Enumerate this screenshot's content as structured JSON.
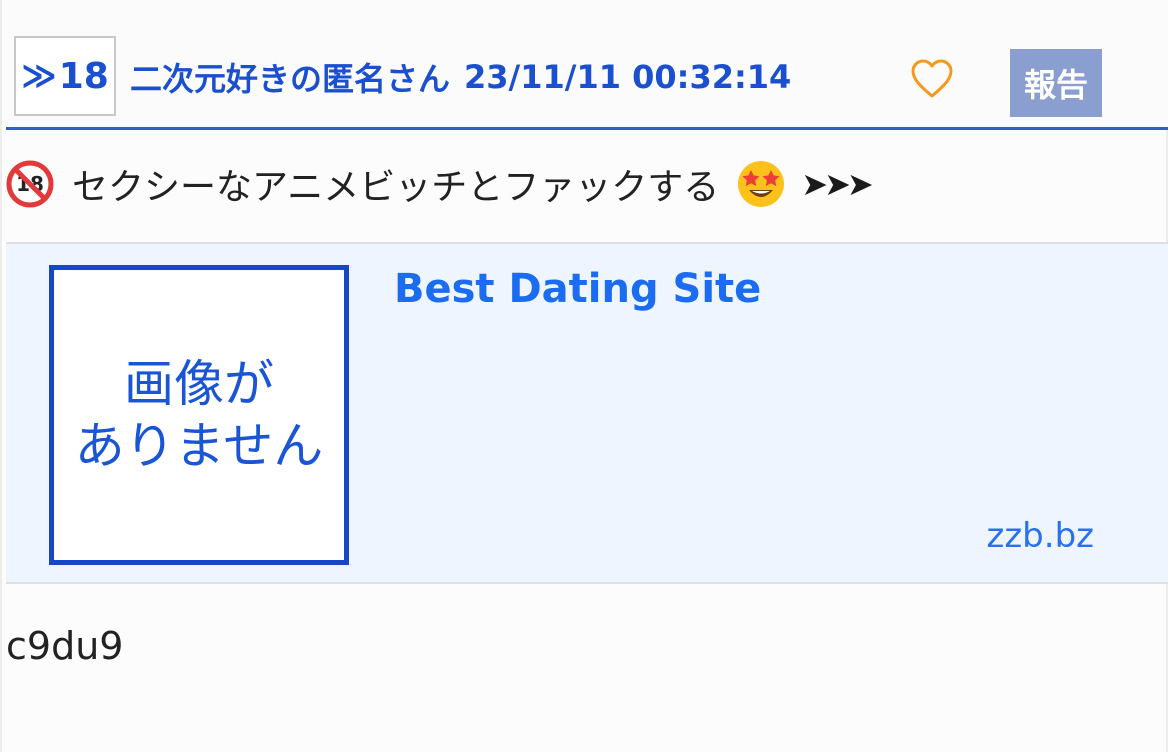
{
  "post": {
    "res_number": "18",
    "res_prefix": "≫",
    "poster_name": "二次元好きの匿名さん",
    "datetime": "23/11/11 00:32:14",
    "report_label": "報告",
    "like_icon": "heart-outline-icon",
    "accent_color": "#1a4fcf",
    "body": {
      "badge_icon": "no-under-18-icon",
      "text": "セクシーなアニメビッチとファックする",
      "emoji_icon": "star-struck-emoji-icon",
      "arrows": "➤➤➤"
    },
    "link_card": {
      "thumbnail_line1": "画像が",
      "thumbnail_line2": "ありません",
      "title": "Best Dating Site",
      "domain": "zzb.bz"
    },
    "id_text": "c9du9"
  }
}
